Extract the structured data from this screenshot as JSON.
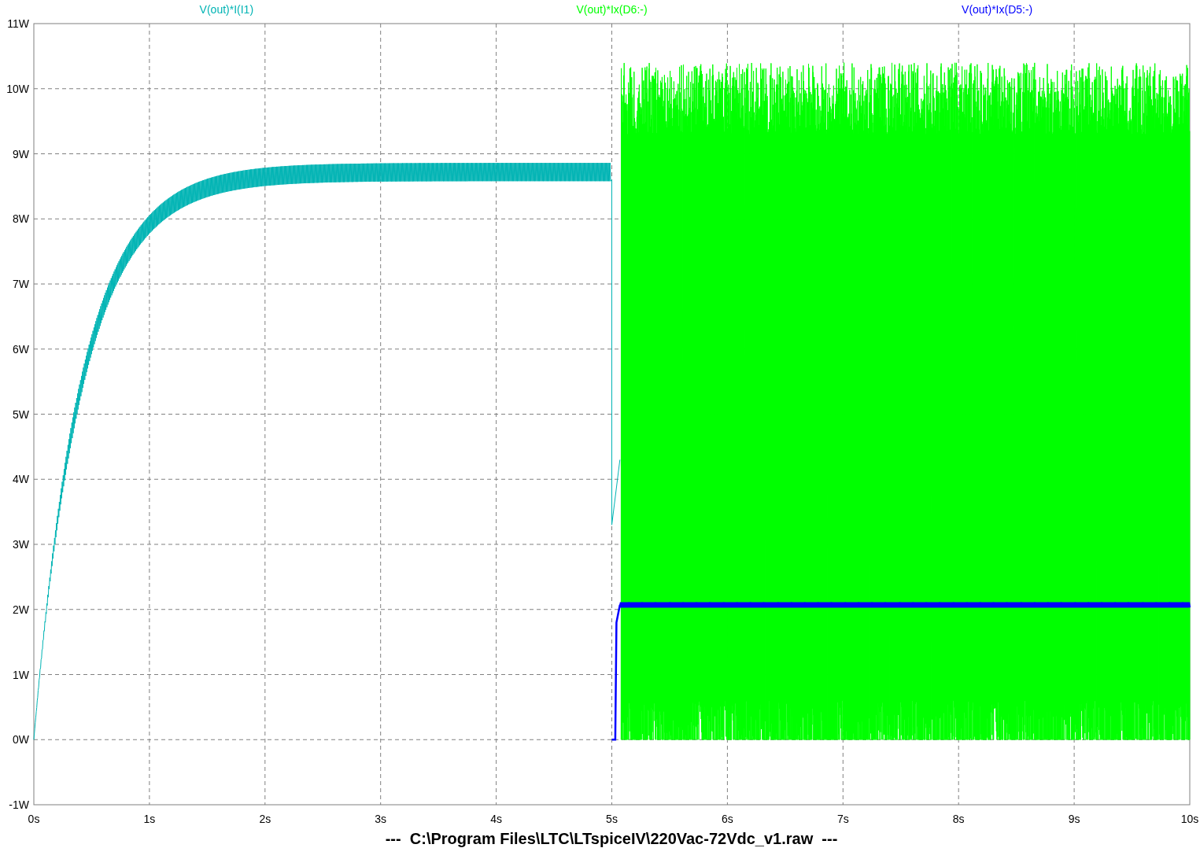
{
  "plot": {
    "traces": [
      {
        "label": "V(out)*I(I1)",
        "color": "#00b4b4",
        "kind": "settle"
      },
      {
        "label": "V(out)*Ix(D6:-)",
        "color": "#00ff00",
        "kind": "pulses"
      },
      {
        "label": "V(out)*Ix(D5:-)",
        "color": "#0000ff",
        "kind": "step"
      }
    ],
    "y_ticks": [
      "11W",
      "10W",
      "9W",
      "8W",
      "7W",
      "6W",
      "5W",
      "4W",
      "3W",
      "2W",
      "1W",
      "0W",
      "-1W"
    ],
    "x_ticks": [
      "0s",
      "1s",
      "2s",
      "3s",
      "4s",
      "5s",
      "6s",
      "7s",
      "8s",
      "9s",
      "10s"
    ]
  },
  "footer": "---  C:\\Program Files\\LTC\\LTspiceIV\\220Vac-72Vdc_v1.raw  ---"
}
